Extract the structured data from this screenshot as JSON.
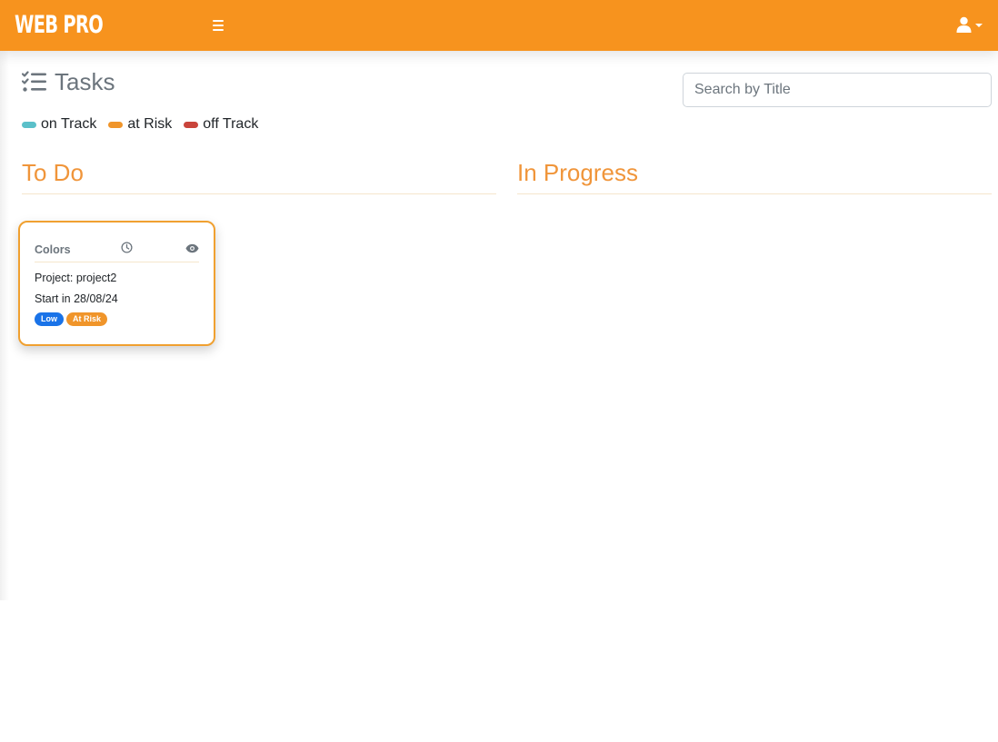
{
  "navbar": {
    "brand": "WEB PRO",
    "colors": {
      "background": "#f7931e",
      "text": "#ffffff"
    },
    "icons": {
      "menu": "hamburger-icon",
      "user": "user-icon",
      "dropdown": "caret-down-icon"
    }
  },
  "page": {
    "title": "Tasks",
    "title_icon": "tasks-list-icon"
  },
  "search": {
    "placeholder": "Search by Title",
    "value": ""
  },
  "legend": [
    {
      "label": "on Track",
      "color": "#5bc0c9"
    },
    {
      "label": "at Risk",
      "color": "#f0952a"
    },
    {
      "label": "off Track",
      "color": "#c9443b"
    }
  ],
  "columns": [
    {
      "title": "To Do"
    },
    {
      "title": "In Progress"
    }
  ],
  "accent_color": "#f0953a",
  "tasks": [
    {
      "title": "Colors",
      "project": "Project: project2",
      "start": "Start in 28/08/24",
      "priority": {
        "label": "Low",
        "color": "#1a73e8"
      },
      "status": {
        "label": "At Risk",
        "color": "#f0952a"
      },
      "icons": {
        "time": "clock-icon",
        "view": "eye-icon"
      }
    }
  ]
}
